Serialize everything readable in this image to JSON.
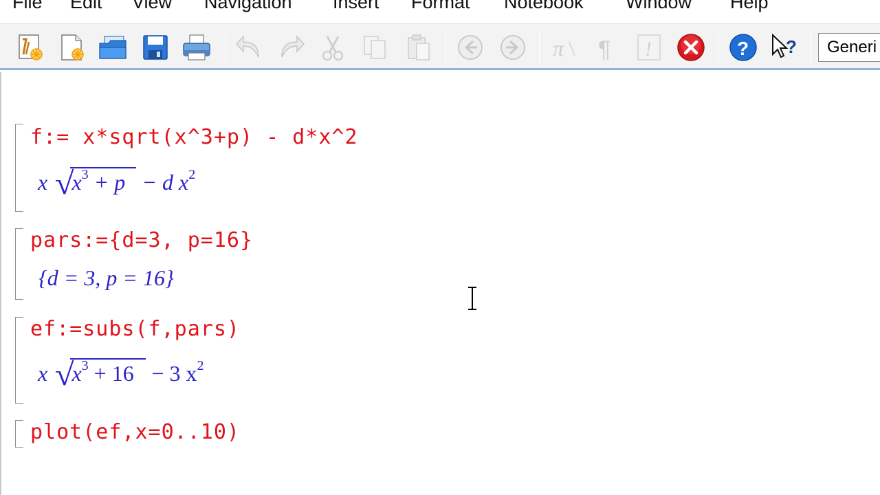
{
  "menu": [
    "File",
    "Edit",
    "View",
    "Navigation",
    "Insert",
    "Format",
    "Notebook",
    "Window",
    "Help"
  ],
  "toolbar": {
    "buttons": [
      {
        "name": "new-worksheet-icon",
        "enabled": true
      },
      {
        "name": "new-file-icon",
        "enabled": true
      },
      {
        "name": "open-folder-icon",
        "enabled": true
      },
      {
        "name": "save-icon",
        "enabled": true
      },
      {
        "name": "print-icon",
        "enabled": true
      },
      {
        "name": "undo-icon",
        "enabled": false
      },
      {
        "name": "redo-icon",
        "enabled": false
      },
      {
        "name": "cut-icon",
        "enabled": false
      },
      {
        "name": "copy-icon",
        "enabled": false
      },
      {
        "name": "paste-icon",
        "enabled": false
      },
      {
        "name": "back-icon",
        "enabled": false
      },
      {
        "name": "forward-icon",
        "enabled": false
      },
      {
        "name": "pi-icon",
        "enabled": false
      },
      {
        "name": "paragraph-icon",
        "enabled": false
      },
      {
        "name": "exclamation-icon",
        "enabled": false
      },
      {
        "name": "stop-icon",
        "enabled": true
      },
      {
        "name": "help-icon",
        "enabled": true
      },
      {
        "name": "context-help-icon",
        "enabled": true
      }
    ],
    "mode_selector": "Generi"
  },
  "worksheet": {
    "groups": [
      {
        "input": "f:= x*sqrt(x^3+p) - d*x^2",
        "output": {
          "a": "x",
          "b": "x",
          "c": "3",
          "d": "+ p",
          "e": "− d x",
          "f": "2"
        }
      },
      {
        "input": "pars:={d=3, p=16}",
        "output": "{d = 3, p = 16}"
      },
      {
        "input": "ef:=subs(f,pars)",
        "output": {
          "a": "x",
          "b": "x",
          "c": "3",
          "d": "+ 16",
          "e": "− 3 x",
          "f": "2"
        }
      },
      {
        "input": "plot(ef,x=0..10)"
      }
    ]
  }
}
